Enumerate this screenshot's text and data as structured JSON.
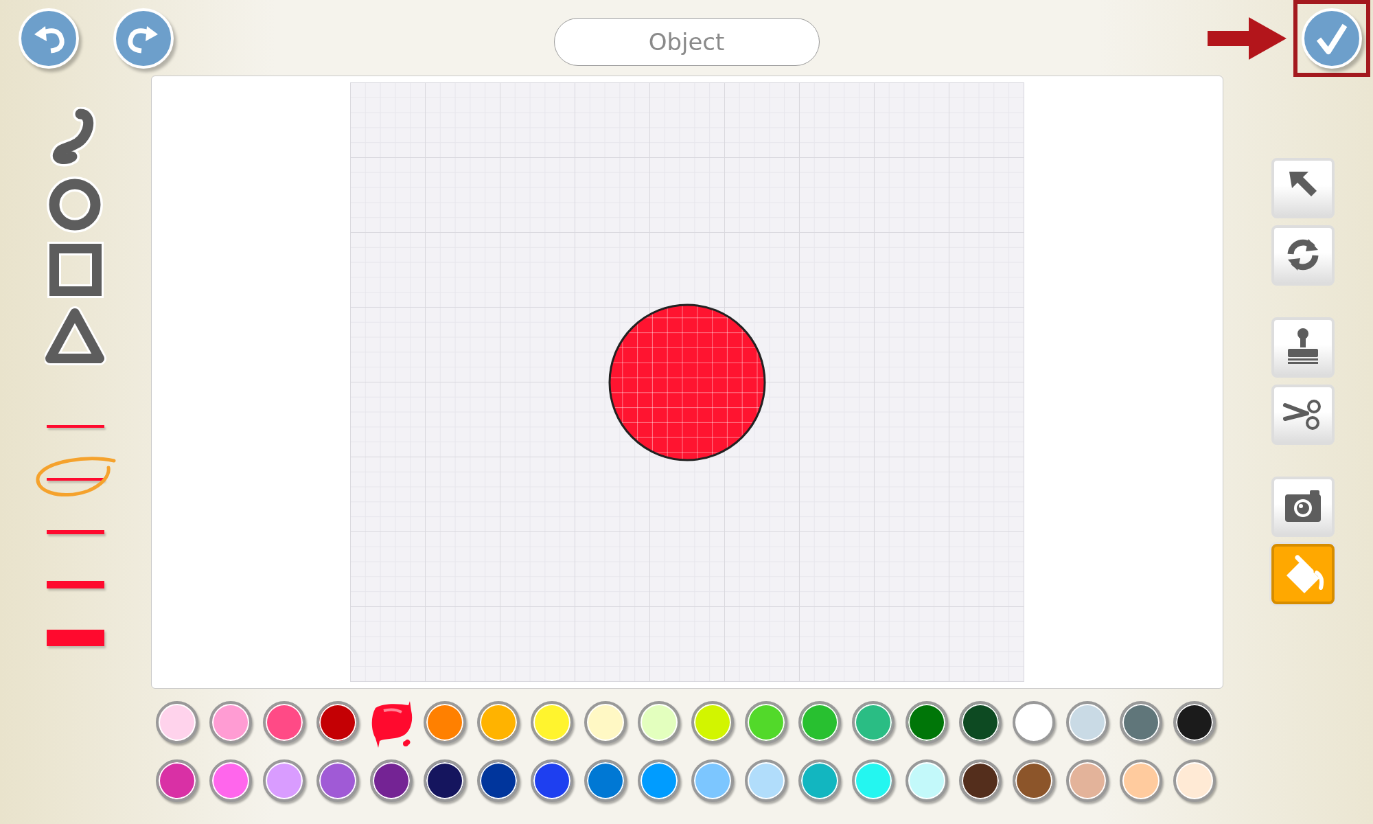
{
  "top_bar": {
    "name_field": {
      "value": "Object"
    },
    "done_button": {
      "highlighted": true
    }
  },
  "shape_tools": [
    {
      "kind": "freehand"
    },
    {
      "kind": "ellipse"
    },
    {
      "kind": "rectangle"
    },
    {
      "kind": "triangle"
    }
  ],
  "line_sizes": [
    {
      "kind": "hairline",
      "selected": false
    },
    {
      "kind": "thin",
      "selected": true
    },
    {
      "kind": "medium",
      "selected": false
    },
    {
      "kind": "thick",
      "selected": false
    },
    {
      "kind": "heavy",
      "selected": false
    }
  ],
  "canvas": {
    "shapes": [
      {
        "kind": "circle",
        "color": "#ff1430"
      }
    ]
  },
  "edit_tools": [
    {
      "kind": "select",
      "selected": false
    },
    {
      "kind": "rotate",
      "selected": false
    },
    {
      "kind": "stamp",
      "selected": false
    },
    {
      "kind": "cut",
      "selected": false
    },
    {
      "kind": "camera",
      "selected": false
    },
    {
      "kind": "fill",
      "selected": true
    }
  ],
  "palette": [
    {
      "color": "#ffd3ec",
      "selected": false
    },
    {
      "color": "#ff9cd3",
      "selected": false
    },
    {
      "color": "#ff4a86",
      "selected": false
    },
    {
      "color": "#c40004",
      "selected": false
    },
    {
      "color": "#ff0a2e",
      "selected": true
    },
    {
      "color": "#ff8000",
      "selected": false
    },
    {
      "color": "#ffb300",
      "selected": false
    },
    {
      "color": "#fff42e",
      "selected": false
    },
    {
      "color": "#fff8c4",
      "selected": false
    },
    {
      "color": "#e3ffbe",
      "selected": false
    },
    {
      "color": "#d2f500",
      "selected": false
    },
    {
      "color": "#52d92a",
      "selected": false
    },
    {
      "color": "#28c030",
      "selected": false
    },
    {
      "color": "#2abd84",
      "selected": false
    },
    {
      "color": "#007608",
      "selected": false
    },
    {
      "color": "#0d4a22",
      "selected": false
    },
    {
      "color": "#ffffff",
      "selected": false
    },
    {
      "color": "#c9dae5",
      "selected": false
    },
    {
      "color": "#60767a",
      "selected": false
    },
    {
      "color": "#1b1b1b",
      "selected": false
    },
    {
      "color": "#d930a5",
      "selected": false
    },
    {
      "color": "#ff66ec",
      "selected": false
    },
    {
      "color": "#d99cff",
      "selected": false
    },
    {
      "color": "#a05ad6",
      "selected": false
    },
    {
      "color": "#742394",
      "selected": false
    },
    {
      "color": "#15155e",
      "selected": false
    },
    {
      "color": "#00359c",
      "selected": false
    },
    {
      "color": "#1e3ff0",
      "selected": false
    },
    {
      "color": "#0078d4",
      "selected": false
    },
    {
      "color": "#009cff",
      "selected": false
    },
    {
      "color": "#7cc6ff",
      "selected": false
    },
    {
      "color": "#b1ddfb",
      "selected": false
    },
    {
      "color": "#12b6c0",
      "selected": false
    },
    {
      "color": "#24f6f0",
      "selected": false
    },
    {
      "color": "#c3f9fa",
      "selected": false
    },
    {
      "color": "#542e1c",
      "selected": false
    },
    {
      "color": "#8c552a",
      "selected": false
    },
    {
      "color": "#e3b39a",
      "selected": false
    },
    {
      "color": "#ffcb9e",
      "selected": false
    },
    {
      "color": "#ffead5",
      "selected": false
    }
  ]
}
